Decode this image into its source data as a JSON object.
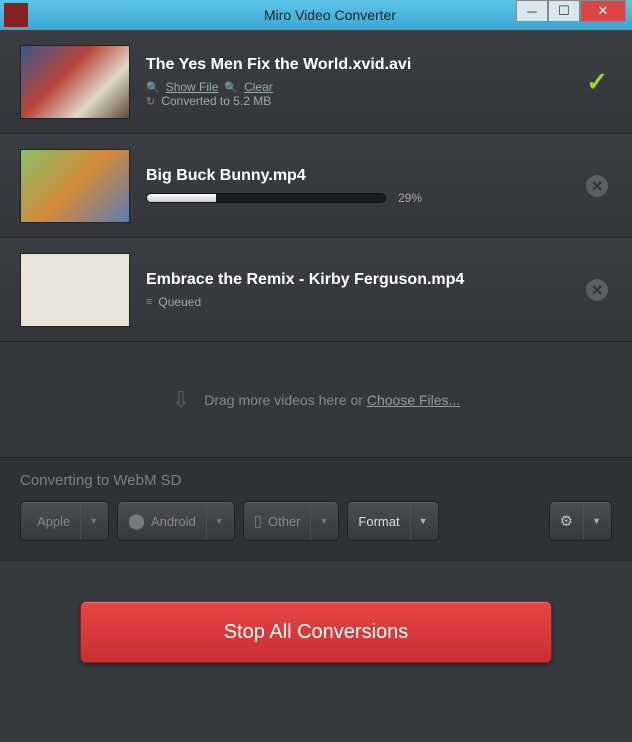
{
  "window": {
    "title": "Miro Video Converter"
  },
  "files": [
    {
      "name": "The Yes Men Fix the World.xvid.avi",
      "show_file_label": "Show File",
      "clear_label": "Clear",
      "converted_text": "Converted to 5.2 MB",
      "status": "done"
    },
    {
      "name": "Big Buck Bunny.mp4",
      "progress_pct": "29%",
      "progress_value": 29,
      "status": "converting"
    },
    {
      "name": "Embrace the Remix - Kirby Ferguson.mp4",
      "queued_label": "Queued",
      "status": "queued"
    }
  ],
  "dropzone": {
    "text": "Drag more videos here or ",
    "link": "Choose Files..."
  },
  "status_line": "Converting to WebM SD",
  "format_buttons": {
    "apple": "Apple",
    "android": "Android",
    "other": "Other",
    "format": "Format"
  },
  "action_button": "Stop All Conversions"
}
